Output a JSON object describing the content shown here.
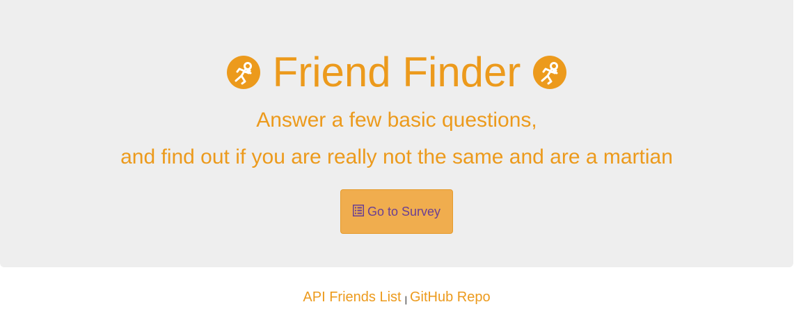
{
  "header": {
    "title": "Friend Finder",
    "icon": "astronaut-icon",
    "subtitle_line1": "Answer a few basic questions,",
    "subtitle_line2": "and find out if you are really not the same and are a martian"
  },
  "survey_button": {
    "label": "Go to Survey",
    "icon": "list-alt-icon"
  },
  "footer": {
    "api_link": "API Friends List",
    "separator": "|",
    "github_link": "GitHub Repo"
  },
  "colors": {
    "accent": "#ec9a1c",
    "button_bg": "#f0ad4e",
    "button_text": "#6a3f93",
    "jumbotron_bg": "#eeeeee"
  }
}
